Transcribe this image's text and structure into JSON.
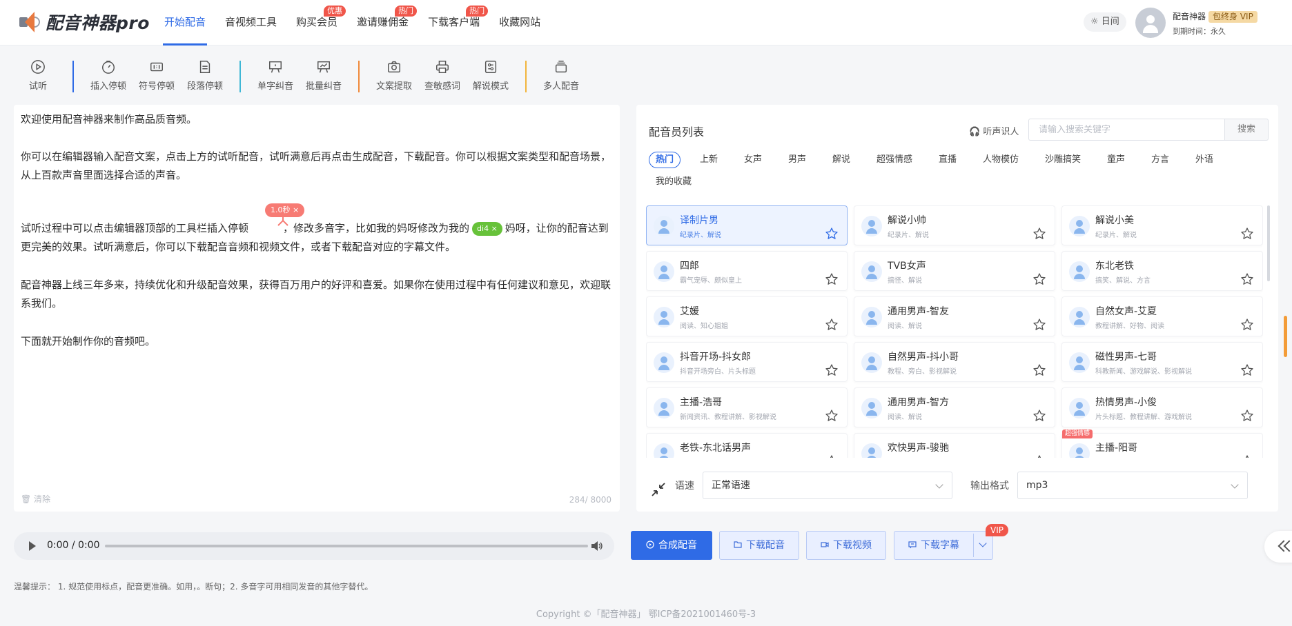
{
  "app": {
    "logo_text": "配音神器pro"
  },
  "nav": [
    {
      "label": "开始配音",
      "active": true,
      "badge": ""
    },
    {
      "label": "音视频工具",
      "badge": ""
    },
    {
      "label": "购买会员",
      "badge": "优惠"
    },
    {
      "label": "邀请赚佣金",
      "badge": "热门"
    },
    {
      "label": "下载客户端",
      "badge": "热门"
    },
    {
      "label": "收藏网站",
      "badge": ""
    }
  ],
  "header": {
    "theme_label": "☼ 日间",
    "user_name": "配音神器",
    "vip_tag": "包终身 VIP",
    "expire_text": "到期时间：永久"
  },
  "toolbar": {
    "preview": "试听",
    "insert_pause": "插入停顿",
    "symbol_pause": "符号停顿",
    "paragraph_pause": "段落停顿",
    "single_pinyin": "单字纠音",
    "batch_pinyin": "批量纠音",
    "text_extract": "文案提取",
    "sensitive_check": "查敏感词",
    "narration_mode": "解说模式",
    "multi_voice": "多人配音"
  },
  "editor": {
    "para1": "欢迎使用配音神器来制作高品质音频。",
    "para2": "你可以在编辑器输入配音文案，点击上方的试听配音，试听满意后再点击生成配音，下载配音。你可以根据文案类型和配音场景，从上百款声音里面选择合适的声音。",
    "para3a": "试听过程中可以点击编辑器顶部的工具栏插入停顿",
    "para3b": "，修改多音字，比如我的妈呀修改为我的",
    "para3c": "妈呀，让你的配音达到更完美的效果。试听满意后，你可以下载配音音频和视频文件，或者下载配音对应的字幕文件。",
    "pause_tag": "1.0秒 ×",
    "pinyin_tag": "di4 ×",
    "para4": "配音神器上线三年多来，持续优化和升级配音效果，获得百万用户的好评和喜爱。如果你在使用过程中有任何建议和意见，欢迎联系我们。",
    "para5": "下面就开始制作你的音频吧。",
    "clear_label": "🗑 清除",
    "char_count": "284/ 8000"
  },
  "voice_panel": {
    "title": "配音员列表",
    "listen_id_label": "🎧 听声识人",
    "search_placeholder": "请输入搜索关键字",
    "search_button": "搜索",
    "categories": [
      "热门",
      "上新",
      "女声",
      "男声",
      "解说",
      "超强情感",
      "直播",
      "人物模仿",
      "沙雕搞笑",
      "童声",
      "方言",
      "外语",
      "我的收藏"
    ],
    "voices": [
      {
        "name": "译制片男",
        "tags": "纪录片、解说",
        "selected": true
      },
      {
        "name": "解说小帅",
        "tags": "纪录片、解说"
      },
      {
        "name": "解说小美",
        "tags": "纪录片、解说"
      },
      {
        "name": "四郎",
        "tags": "霸气宠辱、颇似皇上"
      },
      {
        "name": "TVB女声",
        "tags": "搞怪、解说"
      },
      {
        "name": "东北老铁",
        "tags": "搞笑、解说、方言"
      },
      {
        "name": "艾媛",
        "tags": "阅读、知心姐姐"
      },
      {
        "name": "通用男声-智友",
        "tags": "阅读、解说"
      },
      {
        "name": "自然女声-艾夏",
        "tags": "教程讲解、好物、阅读"
      },
      {
        "name": "抖音开场-抖女郎",
        "tags": "抖音开场旁白、片头标题"
      },
      {
        "name": "自然男声-抖小哥",
        "tags": "教程、旁白、影视解说"
      },
      {
        "name": "磁性男声-七哥",
        "tags": "科教新闻、游戏解说、影视解说"
      },
      {
        "name": "主播-浩哥",
        "tags": "新闻资讯、教程讲解、影视解说"
      },
      {
        "name": "通用男声-智方",
        "tags": "阅读、解说"
      },
      {
        "name": "热情男声-小俊",
        "tags": "片头标题、教程讲解、游戏解说"
      },
      {
        "name": "老铁-东北话男声",
        "tags": ""
      },
      {
        "name": "欢快男声-骏驰",
        "tags": ""
      },
      {
        "name": "主播-阳哥",
        "tags": "",
        "corner": "超强情感"
      }
    ],
    "speed_label": "语速",
    "speed_value": "正常语速",
    "format_label": "输出格式",
    "format_value": "mp3"
  },
  "player": {
    "time": "0:00 / 0:00"
  },
  "actions": {
    "synthesize": "合成配音",
    "download_audio": "下载配音",
    "download_video": "下载视频",
    "download_subtitle": "下载字幕",
    "vip_badge": "VIP"
  },
  "tips": "温馨提示： 1. 规范使用标点，配音更准确。如用，。断句；2. 多音字可用相同发音的其他字替代。",
  "footer": "Copyright ©「配音神器」 鄂ICP备2021001460号-3",
  "colors": {
    "primary": "#2f6be6",
    "badge_red": "#f0564a",
    "pinyin_green": "#67c23a",
    "pause_red": "#f77b74"
  }
}
